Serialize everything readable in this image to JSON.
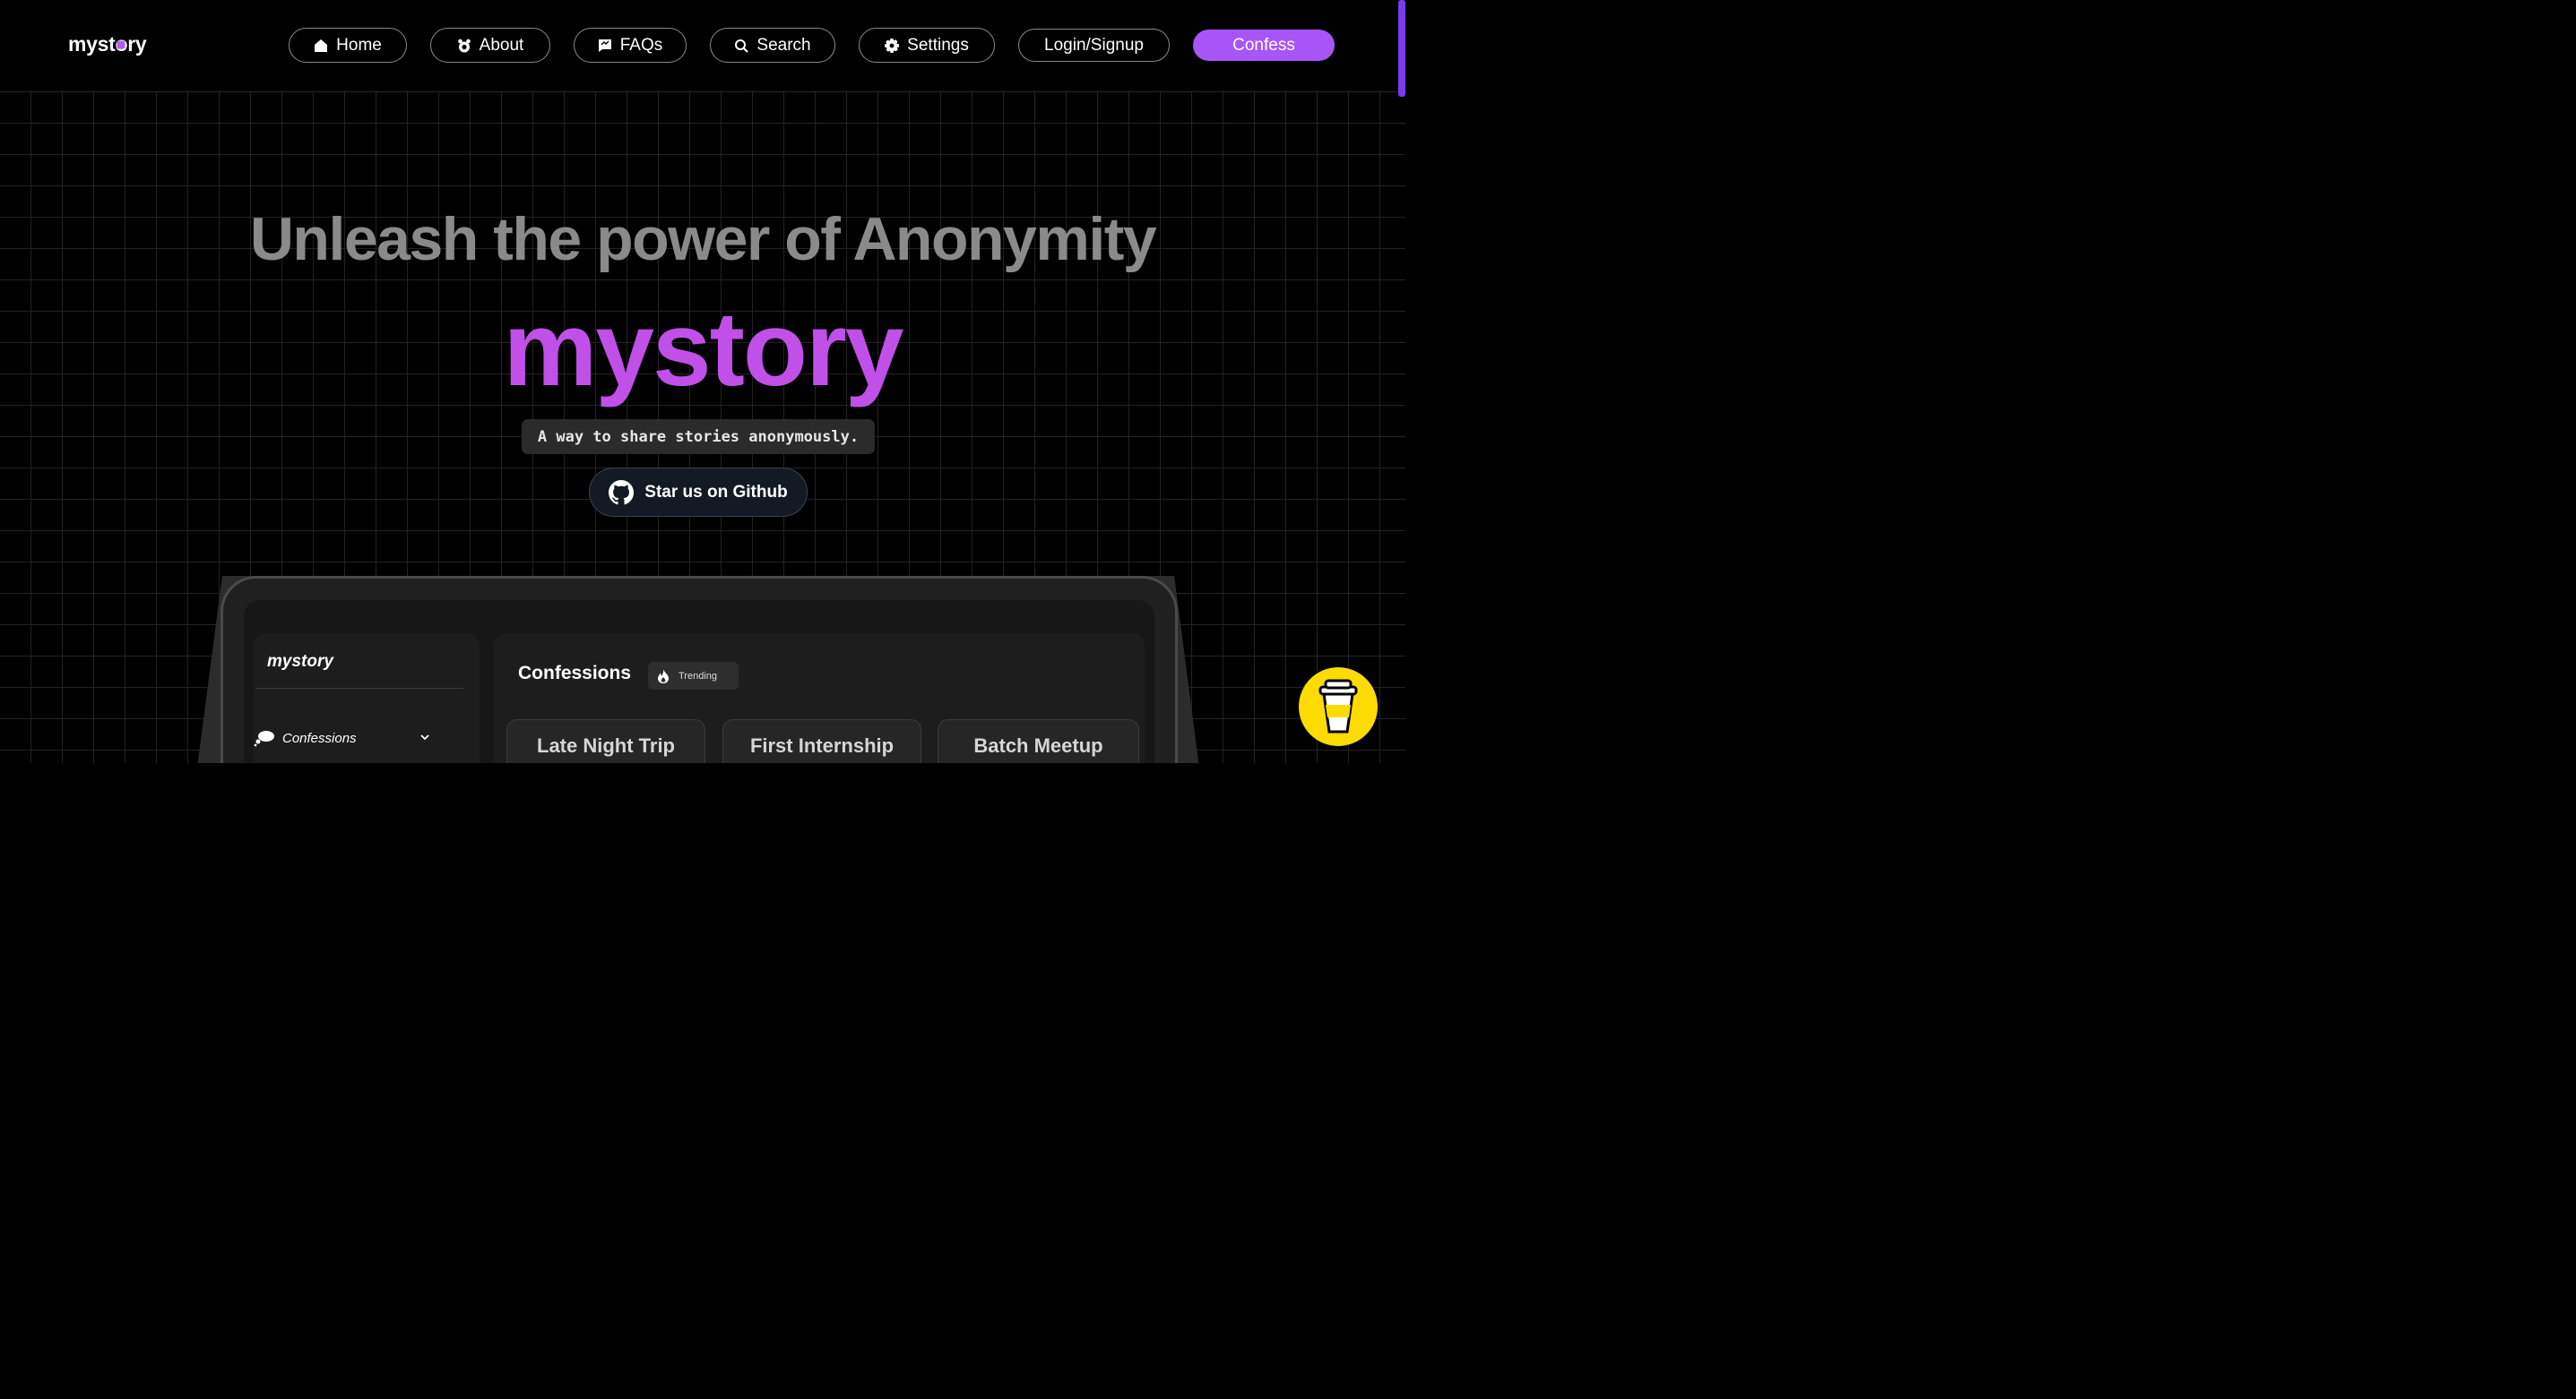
{
  "header": {
    "brand": "mystory",
    "nav": {
      "home": "Home",
      "about": "About",
      "faqs": "FAQs",
      "search": "Search",
      "settings": "Settings",
      "login": "Login/Signup",
      "confess": "Confess"
    }
  },
  "hero": {
    "headline": "Unleash the power of Anonymity",
    "brand": "mystory",
    "tagline": "A way to share stories anonymously.",
    "github_cta": "Star us on Github"
  },
  "preview": {
    "sidebar": {
      "brand": "mystory",
      "item": "Confessions"
    },
    "main": {
      "title": "Confessions",
      "chip": "Trending",
      "cards": [
        "Late Night Trip",
        "First Internship",
        "Batch Meetup"
      ]
    }
  },
  "colors": {
    "accent": "#a855f7",
    "hero_brand": "#c050e8",
    "coffee": "#fcdc00"
  },
  "icons": {
    "home": "home-icon",
    "about": "bear-icon",
    "faqs": "chat-icon",
    "search": "search-icon",
    "settings": "gear-icon",
    "github": "github-icon",
    "trending": "flame-icon",
    "coffee": "coffee-cup-icon"
  }
}
